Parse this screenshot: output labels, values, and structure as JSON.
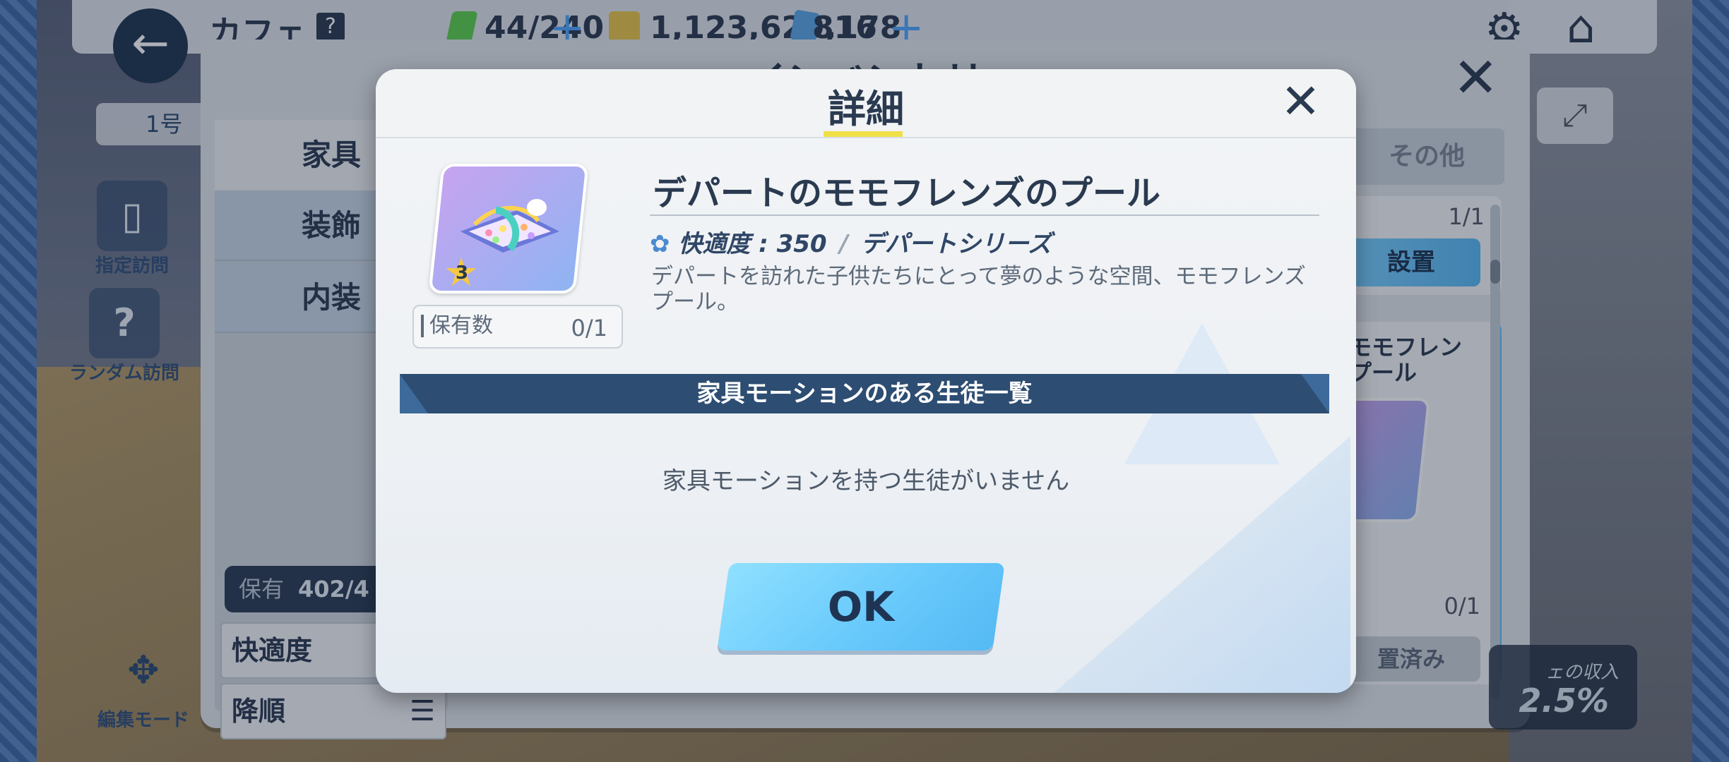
{
  "topbar": {
    "title": "カフェ",
    "help": "?",
    "ap": "44/240",
    "credits": "1,123,629,178",
    "pyroxene": "816",
    "plus": "+"
  },
  "hud": {
    "back": "←",
    "cafe_selector": "1号",
    "visit_invite": "指定訪問",
    "visit_random": "ランダム訪問",
    "edit_mode": "編集モード"
  },
  "inventory": {
    "title": "インベントリ",
    "categories": [
      "家具",
      "装飾",
      "内装"
    ],
    "tab_other": "その他",
    "owned_label": "保有",
    "owned_value": "402/4",
    "sort_field": "快適度",
    "sort_order": "降順",
    "card1_count": "1/1",
    "card1_button": "設置",
    "card2_name_line1": "モモフレン",
    "card2_name_line2": "プール",
    "card2_count": "0/1",
    "card2_button": "置済み",
    "income_label": "ェの収入",
    "income_value": "2.5%"
  },
  "modal": {
    "title": "詳細",
    "item": {
      "name": "デパートのモモフレンズのプール",
      "star": "3",
      "owned_label": "保有数",
      "owned_value": "0/1",
      "comfort_label": "快適度 : 350",
      "series": "デパートシリーズ",
      "description": "デパートを訪れた子供たちにとって夢のような空間、モモフレンズプール。"
    },
    "motion_header": "家具モーションのある生徒一覧",
    "motion_empty": "家具モーションを持つ生徒がいません",
    "ok": "OK"
  },
  "colors": {
    "accent_blue": "#66c8fb",
    "navy": "#2d4d72",
    "title_underline": "#f0e048"
  }
}
